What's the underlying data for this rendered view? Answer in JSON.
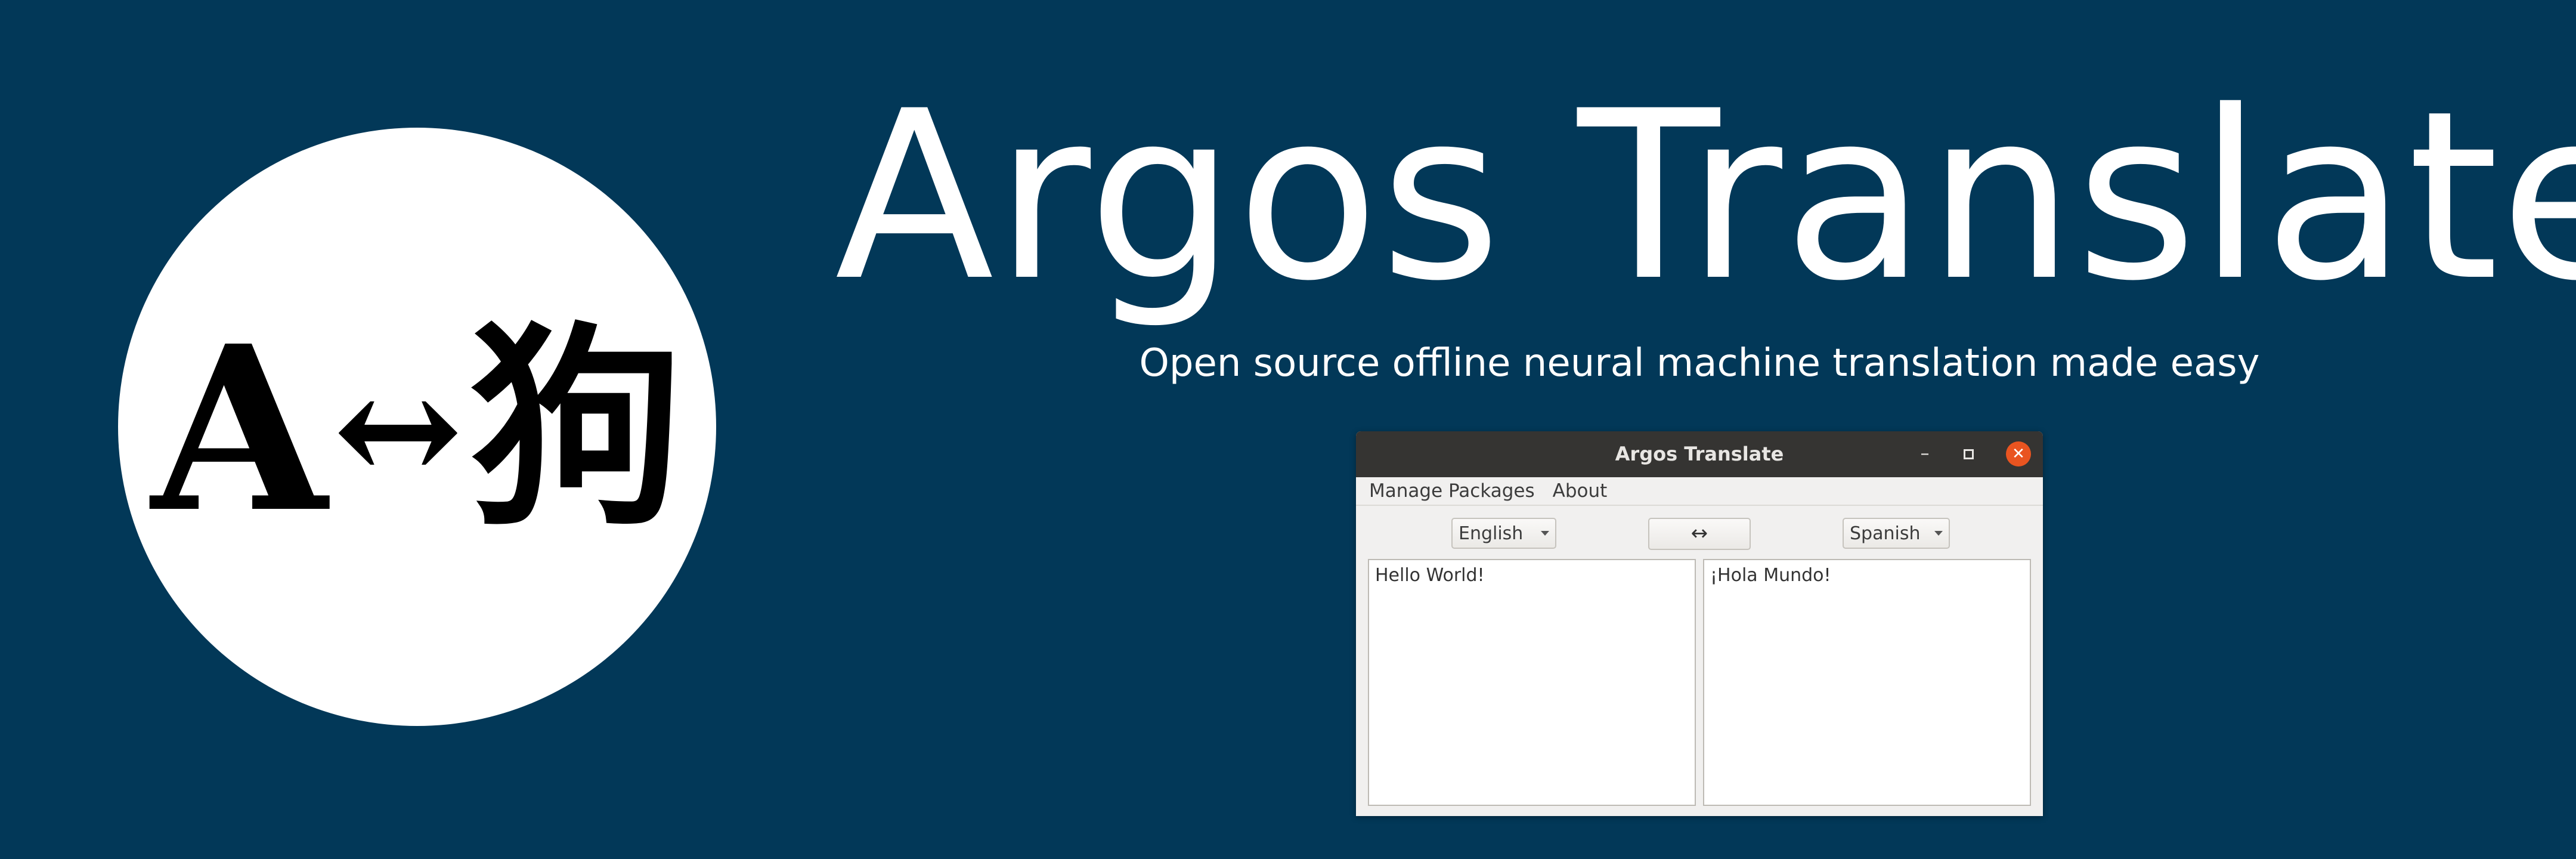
{
  "logo": {
    "glyph_a": "A",
    "glyph_arrow": "↔",
    "glyph_cjk": "狗"
  },
  "hero": {
    "title": "Argos Translate",
    "subtitle": "Open source offline neural machine translation made easy"
  },
  "window": {
    "title": "Argos Translate",
    "controls": {
      "minimize": "–",
      "close": "✕"
    },
    "menu": [
      "Manage Packages",
      "About"
    ],
    "source_language": "English",
    "target_language": "Spanish",
    "swap_label": "↔",
    "input_text": "Hello World!",
    "output_text": "¡Hola Mundo!"
  },
  "colors": {
    "background": "#023858",
    "titlebar": "#353432",
    "close_button": "#e95420"
  }
}
